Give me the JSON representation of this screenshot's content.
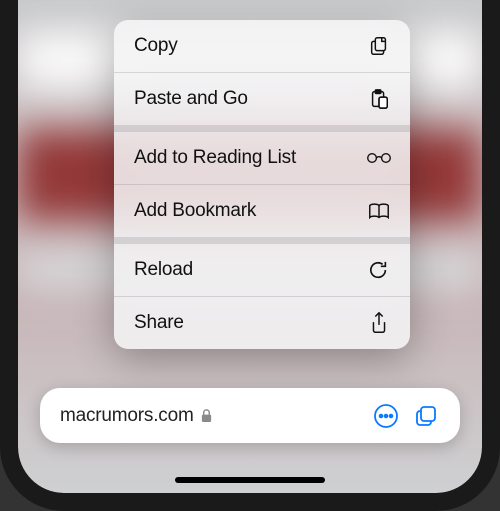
{
  "context_menu": {
    "groups": [
      [
        {
          "label": "Copy",
          "icon": "copy-doc-icon",
          "name": "menu-item-copy"
        },
        {
          "label": "Paste and Go",
          "icon": "paste-clipboard-icon",
          "name": "menu-item-paste-and-go"
        }
      ],
      [
        {
          "label": "Add to Reading List",
          "icon": "glasses-icon",
          "name": "menu-item-add-reading-list"
        },
        {
          "label": "Add Bookmark",
          "icon": "book-icon",
          "name": "menu-item-add-bookmark"
        }
      ],
      [
        {
          "label": "Reload",
          "icon": "reload-icon",
          "name": "menu-item-reload"
        },
        {
          "label": "Share",
          "icon": "share-icon",
          "name": "menu-item-share"
        }
      ]
    ]
  },
  "bottom_bar": {
    "url": "macrumors.com",
    "secure": true,
    "more_button": "more-options",
    "tabs_button": "tabs"
  },
  "colors": {
    "accent": "#0a7aff"
  }
}
